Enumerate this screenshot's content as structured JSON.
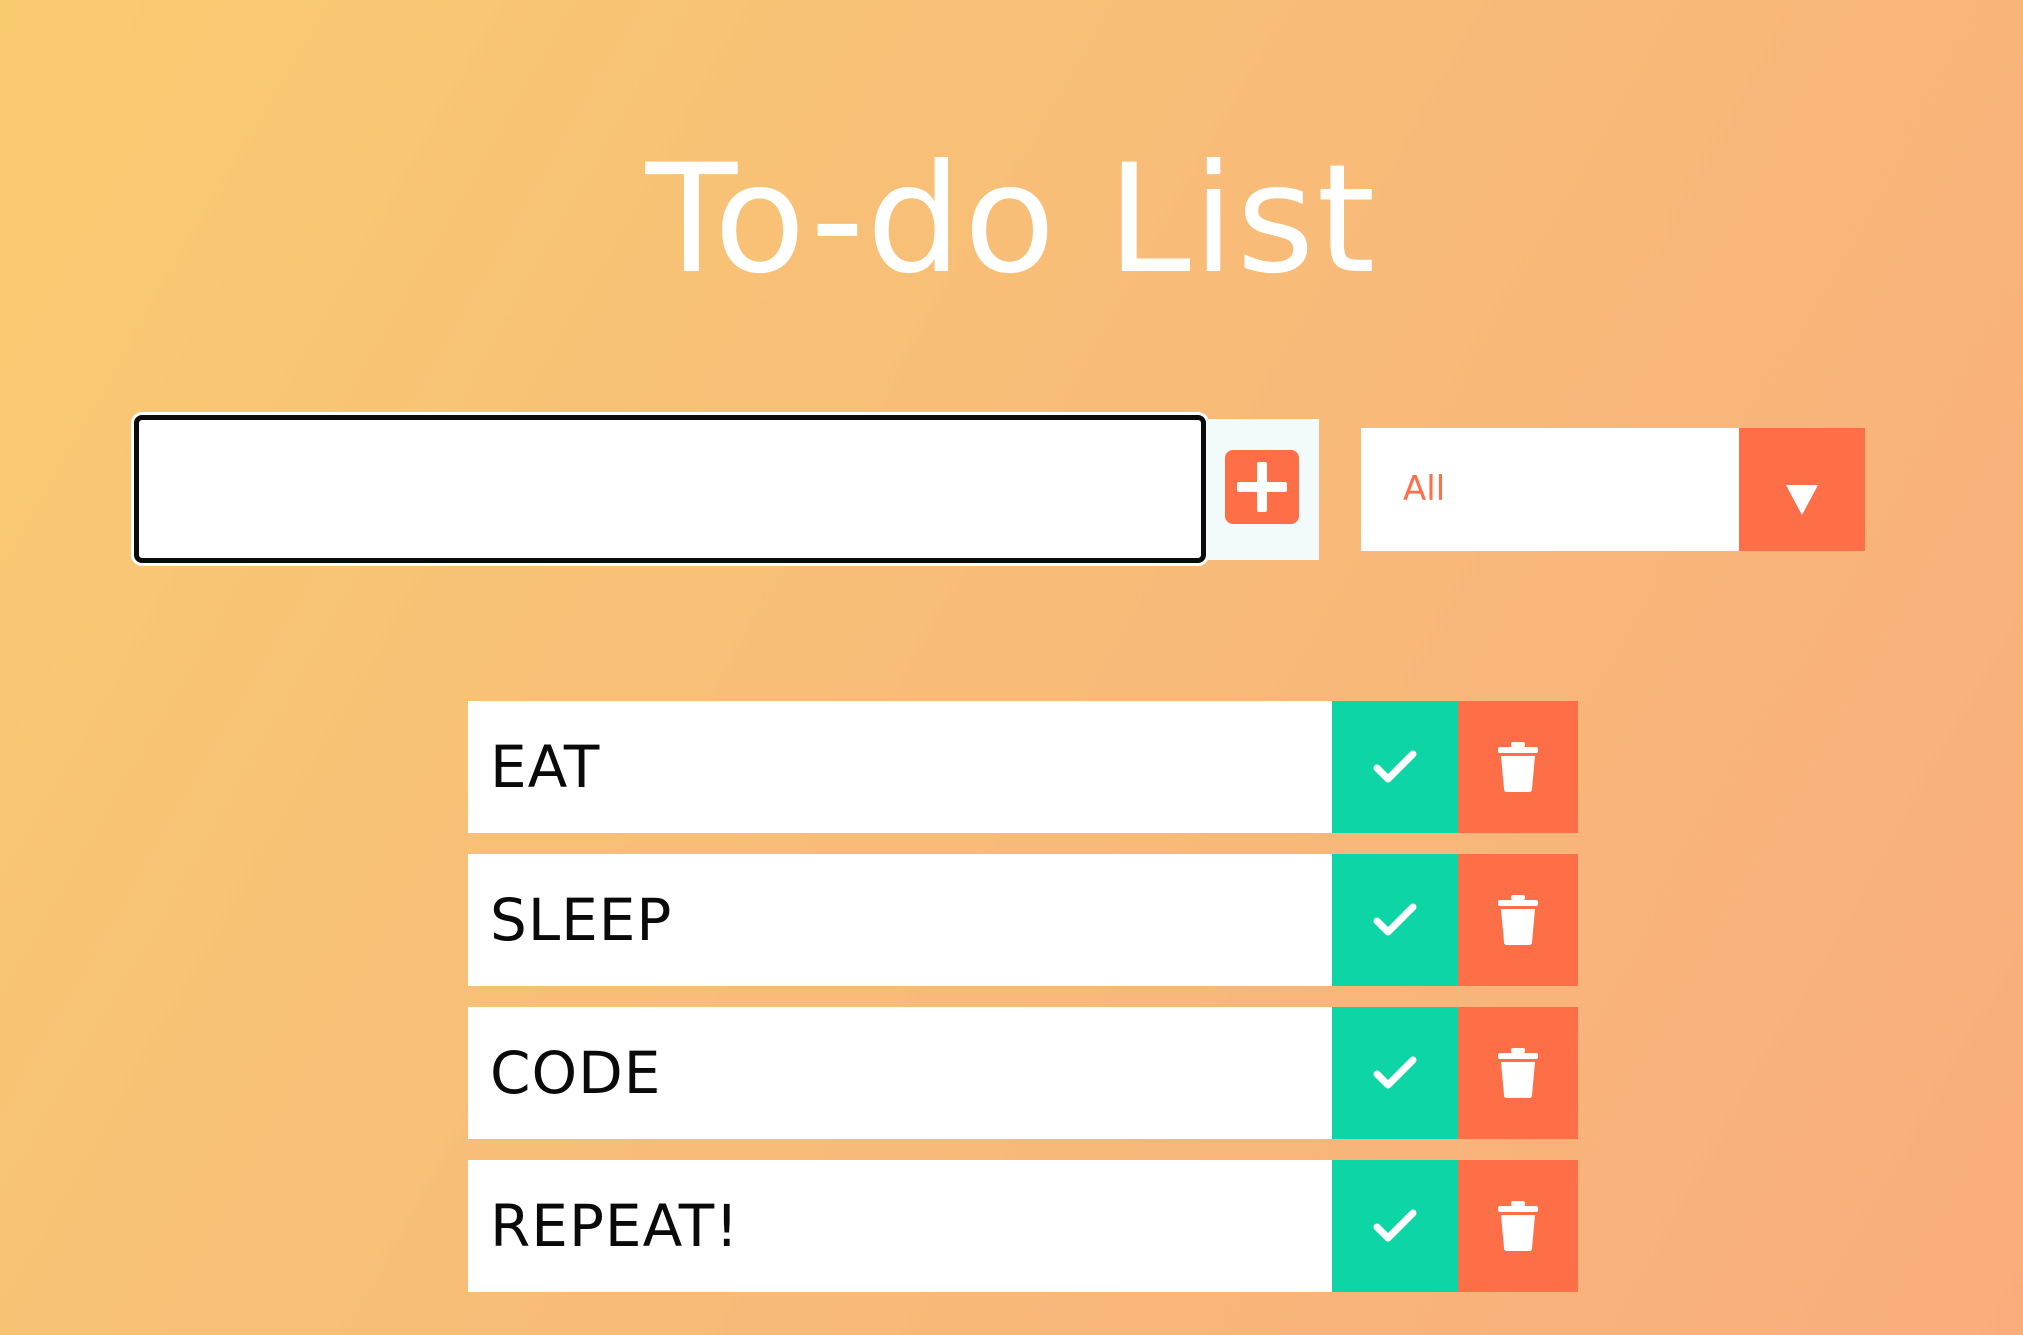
{
  "app": {
    "title": "To-do List"
  },
  "input": {
    "value": "",
    "placeholder": ""
  },
  "add_button": {
    "icon": "plus-square-icon"
  },
  "filter": {
    "selected": "All"
  },
  "todos": [
    {
      "text": "EAT"
    },
    {
      "text": "SLEEP"
    },
    {
      "text": "CODE"
    },
    {
      "text": "REPEAT!"
    }
  ],
  "colors": {
    "background_start": "#f9cb71",
    "background_end": "#f9ad7c",
    "accent": "#ff6f47",
    "complete": "#0dd5a5",
    "item_background": "#ffffff",
    "title": "#ffffff"
  },
  "icons": {
    "complete": "check-icon",
    "delete": "trash-icon",
    "dropdown": "triangle-down-icon"
  }
}
